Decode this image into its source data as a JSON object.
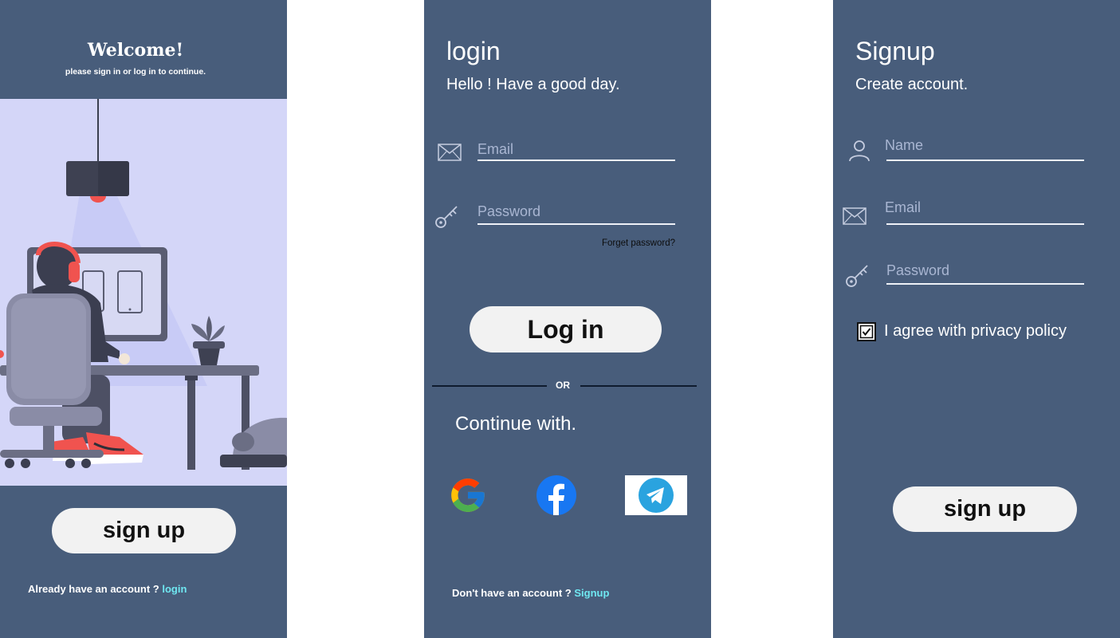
{
  "welcome": {
    "title": "Welcome!",
    "subtitle": "please sign in or log in to continue.",
    "signup_button": "sign up",
    "footer_prefix": "Already have an account ?",
    "footer_link": "login"
  },
  "login": {
    "title": "login",
    "subtitle": "Hello ! Have a good day.",
    "email_placeholder": "Email",
    "password_placeholder": "Password",
    "forgot": "Forget password?",
    "login_button": "Log in",
    "or": "OR",
    "continue": "Continue with.",
    "footer_prefix": "Don't have an account ?",
    "footer_link": "Signup",
    "social": [
      "google-icon",
      "facebook-icon",
      "telegram-icon"
    ]
  },
  "signup": {
    "title": "Signup",
    "subtitle": "Create account.",
    "name_placeholder": "Name",
    "email_placeholder": "Email",
    "password_placeholder": "Password",
    "agree": "I agree with privacy policy",
    "agree_checked": true,
    "signup_button": "sign up"
  },
  "colors": {
    "panel": "#485d7b",
    "pill": "#f2f2f2",
    "link": "#6fe7f1",
    "illustration_bg": "#d4d6f8"
  }
}
